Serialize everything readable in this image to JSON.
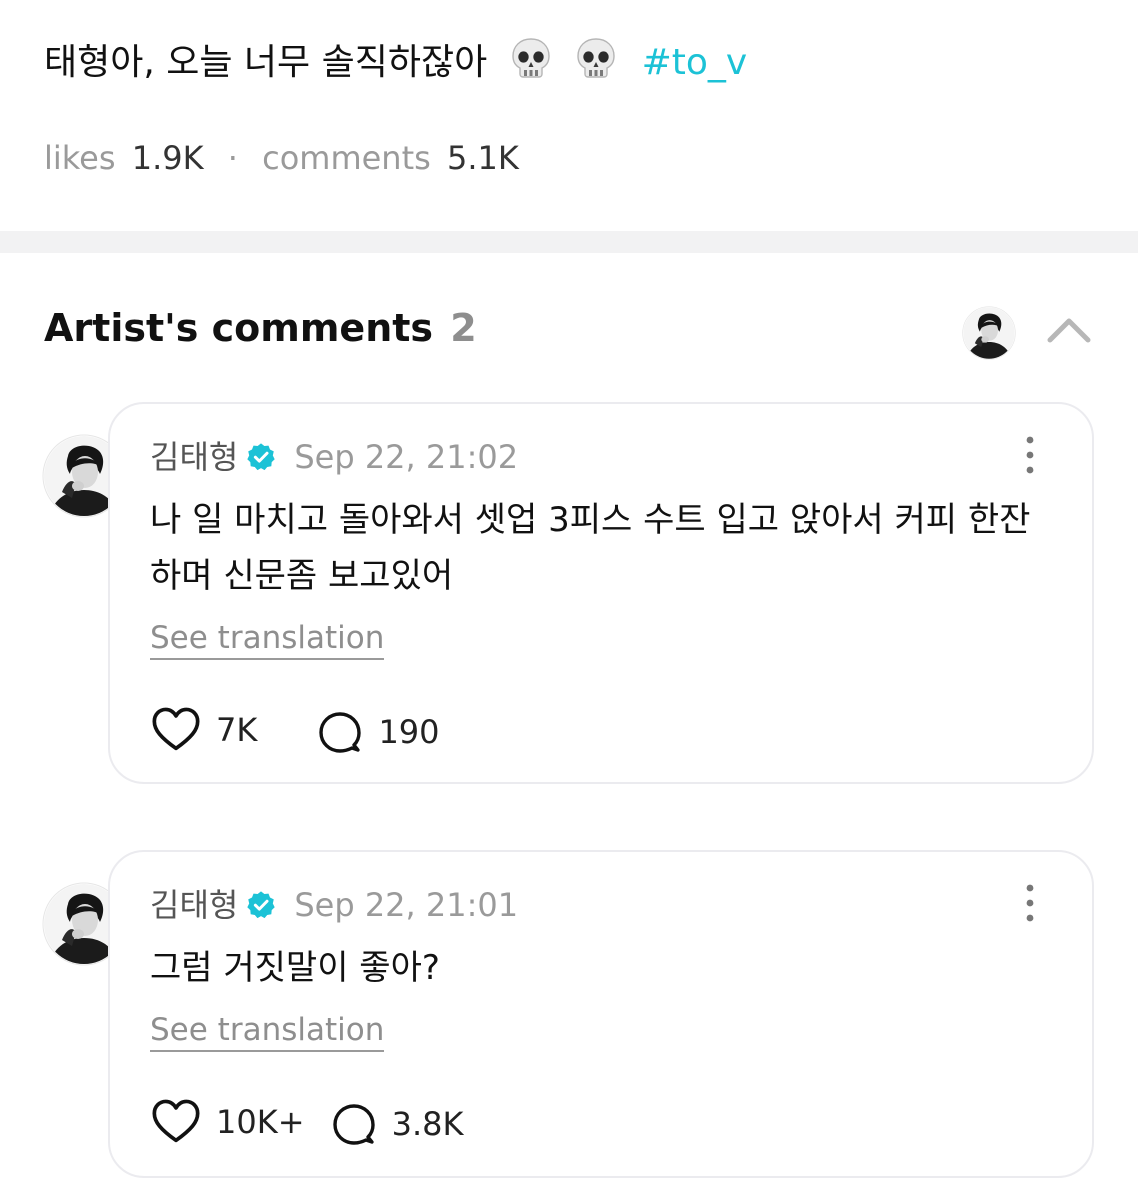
{
  "post": {
    "text": "태형아, 오늘 너무 솔직하잖아",
    "emoji": [
      "skull-icon",
      "skull-icon"
    ],
    "hashtag": "#to_v"
  },
  "stats": {
    "likes_label": "likes",
    "likes_value": "1.9K",
    "separator": "·",
    "comments_label": "comments",
    "comments_value": "5.1K"
  },
  "section": {
    "title": "Artist's comments",
    "count": "2"
  },
  "comments": [
    {
      "author": "김태형",
      "timestamp": "Sep 22, 21:02",
      "text": "나 일 마치고 돌아와서 셋업 3피스 수트 입고 앉아서 커피 한잔하며 신문좀 보고있어",
      "translate_label": "See translation",
      "likes": "7K",
      "replies": "190"
    },
    {
      "author": "김태형",
      "timestamp": "Sep 22, 21:01",
      "text": "그럼 거짓말이 좋아?",
      "translate_label": "See translation",
      "likes": "10K+",
      "replies": "3.8K"
    }
  ],
  "colors": {
    "hashtag": "#1cc2d6",
    "verified": "#1cc2d6",
    "muted": "#9a9a9a",
    "card_border": "#ebebef"
  }
}
